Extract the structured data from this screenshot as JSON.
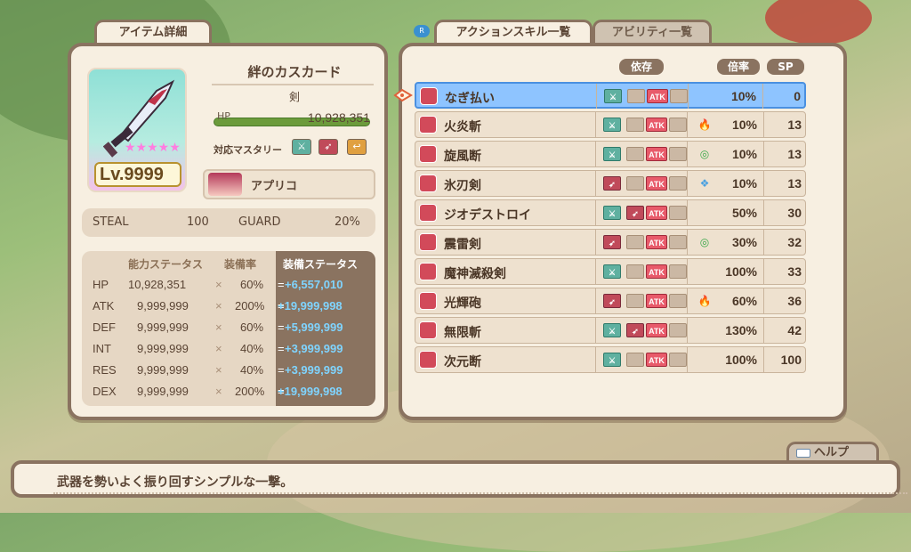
{
  "left": {
    "tab": "アイテム詳細",
    "item_name": "絆のカスカード",
    "item_type": "剣",
    "hp_label": "HP",
    "hp_value": "10,928,351",
    "hp_fraction": 0.98,
    "mastery_label": "対応マスタリー",
    "mastery_icons": [
      "sword-mastery-icon",
      "axe-mastery-icon",
      "boomerang-mastery-icon"
    ],
    "level": "Lv.9999",
    "stars": "★★★★★",
    "character": "アプリコ",
    "steal_label": "STEAL",
    "steal_value": "100",
    "guard_label": "GUARD",
    "guard_value": "20%",
    "status_headers": [
      "能力ステータス",
      "装備率",
      "装備ステータス"
    ],
    "stats": [
      {
        "name": "HP",
        "base": "10,928,351",
        "x": "×",
        "rate": "60%",
        "result": "+6,557,010"
      },
      {
        "name": "ATK",
        "base": "9,999,999",
        "x": "×",
        "rate": "200%",
        "result": "+19,999,998"
      },
      {
        "name": "DEF",
        "base": "9,999,999",
        "x": "×",
        "rate": "60%",
        "result": "+5,999,999"
      },
      {
        "name": "INT",
        "base": "9,999,999",
        "x": "×",
        "rate": "40%",
        "result": "+3,999,999"
      },
      {
        "name": "RES",
        "base": "9,999,999",
        "x": "×",
        "rate": "40%",
        "result": "+3,999,999"
      },
      {
        "name": "DEX",
        "base": "9,999,999",
        "x": "×",
        "rate": "200%",
        "result": "+19,999,998"
      }
    ]
  },
  "right": {
    "tabs": [
      "アクションスキル一覧",
      "アビリティ一覧"
    ],
    "headers": {
      "dep": "依存",
      "rate": "倍率",
      "sp": "SP"
    },
    "skills": [
      {
        "name": "なぎ払い",
        "deps": [
          "sword",
          "empty"
        ],
        "elem": "",
        "rate": "10%",
        "sp": "0"
      },
      {
        "name": "火炎斬",
        "deps": [
          "sword",
          "empty"
        ],
        "elem": "fire",
        "rate": "10%",
        "sp": "13"
      },
      {
        "name": "旋風断",
        "deps": [
          "sword",
          "empty"
        ],
        "elem": "wind",
        "rate": "10%",
        "sp": "13"
      },
      {
        "name": "氷刃剣",
        "deps": [
          "axe",
          "empty"
        ],
        "elem": "ice",
        "rate": "10%",
        "sp": "13"
      },
      {
        "name": "ジオデストロイ",
        "deps": [
          "sword",
          "axe"
        ],
        "elem": "",
        "rate": "50%",
        "sp": "30"
      },
      {
        "name": "震雷剣",
        "deps": [
          "axe",
          "empty"
        ],
        "elem": "wind",
        "rate": "30%",
        "sp": "32"
      },
      {
        "name": "魔神滅殺剣",
        "deps": [
          "sword",
          "empty"
        ],
        "elem": "",
        "rate": "100%",
        "sp": "33"
      },
      {
        "name": "光輝砲",
        "deps": [
          "axe",
          "empty"
        ],
        "elem": "fire",
        "rate": "60%",
        "sp": "36"
      },
      {
        "name": "無限斬",
        "deps": [
          "sword",
          "axe"
        ],
        "elem": "",
        "rate": "130%",
        "sp": "42"
      },
      {
        "name": "次元断",
        "deps": [
          "sword",
          "empty"
        ],
        "elem": "",
        "rate": "100%",
        "sp": "100"
      }
    ],
    "atk_label": "ATK"
  },
  "help": {
    "label": "ヘルプ"
  },
  "description": "武器を勢いよく振り回すシンプルな一撃。",
  "colors": {
    "panel": "#f7efe1",
    "border": "#8a7360",
    "selected": "#8ec4ff",
    "accent_blue": "#7fd4ff"
  }
}
